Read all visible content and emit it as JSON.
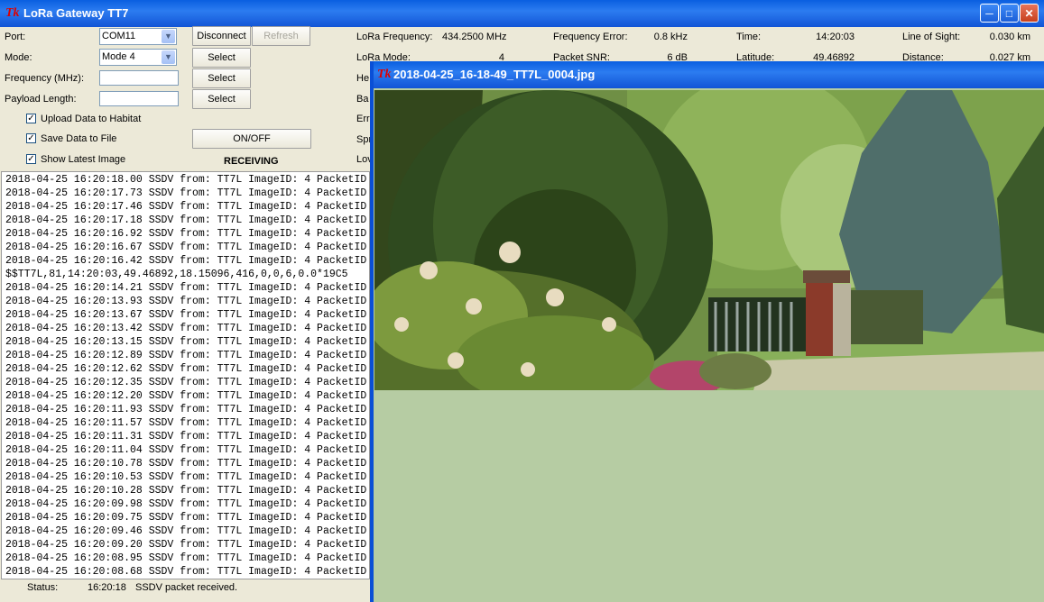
{
  "window": {
    "title": "LoRa Gateway TT7",
    "logo_text": "Tk"
  },
  "form": {
    "port_label": "Port:",
    "port_value": "COM11",
    "mode_label": "Mode:",
    "mode_value": "Mode 4",
    "frequency_label": "Frequency (MHz):",
    "frequency_value": "",
    "payload_label": "Payload Length:",
    "payload_value": "",
    "disconnect_label": "Disconnect",
    "refresh_label": "Refresh",
    "select_label": "Select",
    "onoff_label": "ON/OFF",
    "receiving_text": "RECEIVING",
    "upload_label": "Upload Data to Habitat",
    "save_label": "Save Data to File",
    "show_image_label": "Show Latest Image"
  },
  "info": {
    "lora_freq_label": "LoRa Frequency:",
    "lora_freq_value": "434.2500 MHz",
    "freq_error_label": "Frequency Error:",
    "freq_error_value": "0.8 kHz",
    "time_label": "Time:",
    "time_value": "14:20:03",
    "los_label": "Line of Sight:",
    "los_value": "0.030 km",
    "lora_mode_label": "LoRa Mode:",
    "lora_mode_value": "4",
    "snr_label": "Packet SNR:",
    "snr_value": "6 dB",
    "latitude_label": "Latitude:",
    "latitude_value": "49.46892",
    "distance_label": "Distance:",
    "distance_value": "0.027 km",
    "partial_labels": [
      "He",
      "Ba",
      "Err",
      "Spr",
      "Lov"
    ]
  },
  "log": [
    "2018-04-25 16:20:18.00 SSDV from: TT7L ImageID: 4 PacketID",
    "2018-04-25 16:20:17.73 SSDV from: TT7L ImageID: 4 PacketID",
    "2018-04-25 16:20:17.46 SSDV from: TT7L ImageID: 4 PacketID",
    "2018-04-25 16:20:17.18 SSDV from: TT7L ImageID: 4 PacketID",
    "2018-04-25 16:20:16.92 SSDV from: TT7L ImageID: 4 PacketID",
    "2018-04-25 16:20:16.67 SSDV from: TT7L ImageID: 4 PacketID",
    "2018-04-25 16:20:16.42 SSDV from: TT7L ImageID: 4 PacketID",
    "$$TT7L,81,14:20:03,49.46892,18.15096,416,0,0,6,0.0*19C5",
    "2018-04-25 16:20:14.21 SSDV from: TT7L ImageID: 4 PacketID",
    "2018-04-25 16:20:13.93 SSDV from: TT7L ImageID: 4 PacketID",
    "2018-04-25 16:20:13.67 SSDV from: TT7L ImageID: 4 PacketID",
    "2018-04-25 16:20:13.42 SSDV from: TT7L ImageID: 4 PacketID",
    "2018-04-25 16:20:13.15 SSDV from: TT7L ImageID: 4 PacketID",
    "2018-04-25 16:20:12.89 SSDV from: TT7L ImageID: 4 PacketID",
    "2018-04-25 16:20:12.62 SSDV from: TT7L ImageID: 4 PacketID",
    "2018-04-25 16:20:12.35 SSDV from: TT7L ImageID: 4 PacketID",
    "2018-04-25 16:20:12.20 SSDV from: TT7L ImageID: 4 PacketID",
    "2018-04-25 16:20:11.93 SSDV from: TT7L ImageID: 4 PacketID",
    "2018-04-25 16:20:11.57 SSDV from: TT7L ImageID: 4 PacketID",
    "2018-04-25 16:20:11.31 SSDV from: TT7L ImageID: 4 PacketID",
    "2018-04-25 16:20:11.04 SSDV from: TT7L ImageID: 4 PacketID",
    "2018-04-25 16:20:10.78 SSDV from: TT7L ImageID: 4 PacketID",
    "2018-04-25 16:20:10.53 SSDV from: TT7L ImageID: 4 PacketID",
    "2018-04-25 16:20:10.28 SSDV from: TT7L ImageID: 4 PacketID",
    "2018-04-25 16:20:09.98 SSDV from: TT7L ImageID: 4 PacketID",
    "2018-04-25 16:20:09.75 SSDV from: TT7L ImageID: 4 PacketID",
    "2018-04-25 16:20:09.46 SSDV from: TT7L ImageID: 4 PacketID",
    "2018-04-25 16:20:09.20 SSDV from: TT7L ImageID: 4 PacketID",
    "2018-04-25 16:20:08.95 SSDV from: TT7L ImageID: 4 PacketID",
    "2018-04-25 16:20:08.68 SSDV from: TT7L ImageID: 4 PacketID"
  ],
  "status": {
    "label": "Status:",
    "time": "16:20:18",
    "message": "SSDV packet received."
  },
  "image_window": {
    "title": "2018-04-25_16-18-49_TT7L_0004.jpg"
  },
  "colors": {
    "titlebar": "#1254d6",
    "window_bg": "#ece9d8",
    "image_bg": "#b6cca3"
  }
}
